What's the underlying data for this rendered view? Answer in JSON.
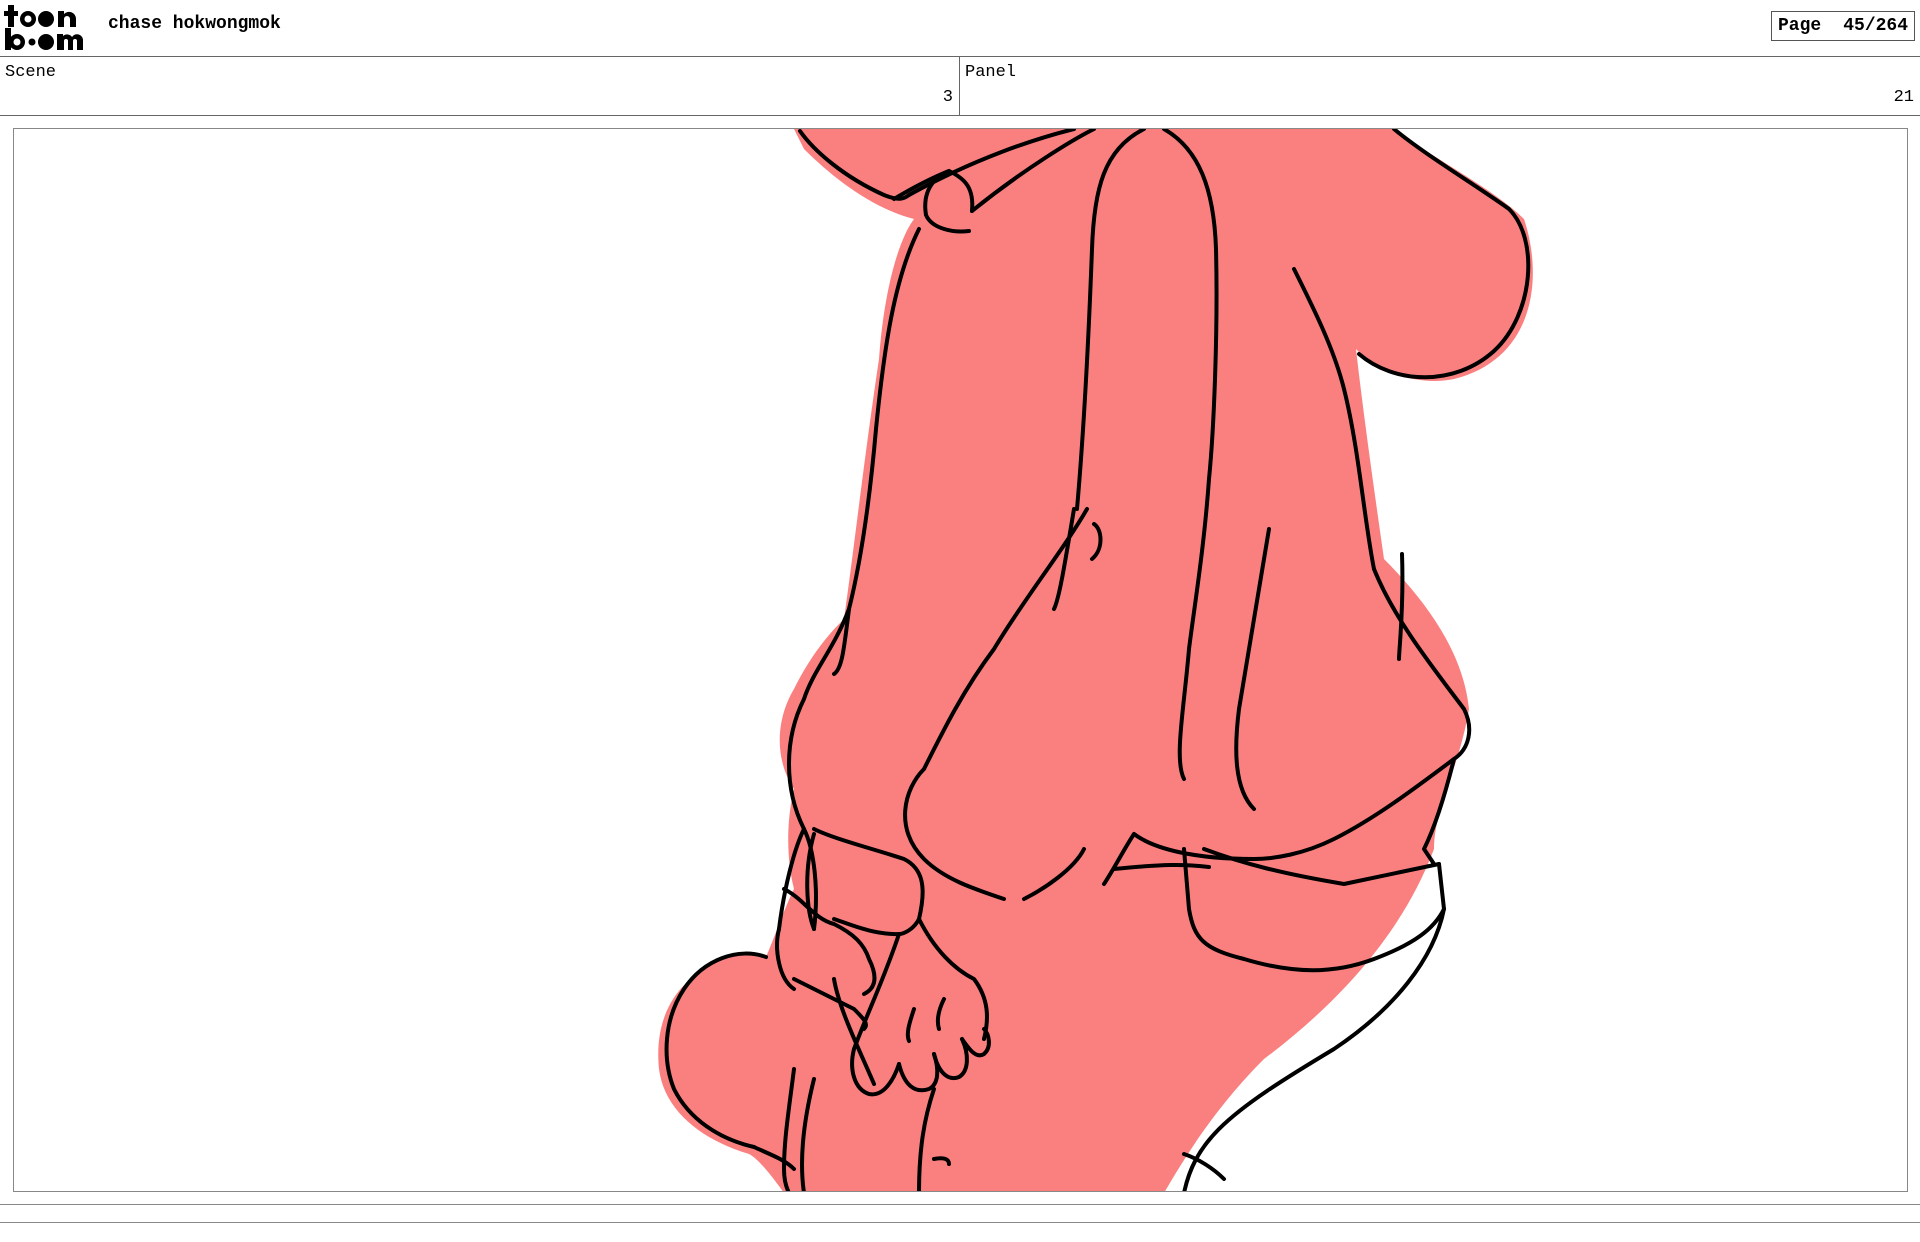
{
  "header": {
    "author": "chase hokwongmok",
    "page_label": "Page",
    "page_number": "45/264"
  },
  "scene": {
    "label": "Scene",
    "value": "3"
  },
  "panel": {
    "label": "Panel",
    "value": "21"
  },
  "colors": {
    "fill": "#fa8080",
    "line": "#000000",
    "frame": "#888888"
  }
}
